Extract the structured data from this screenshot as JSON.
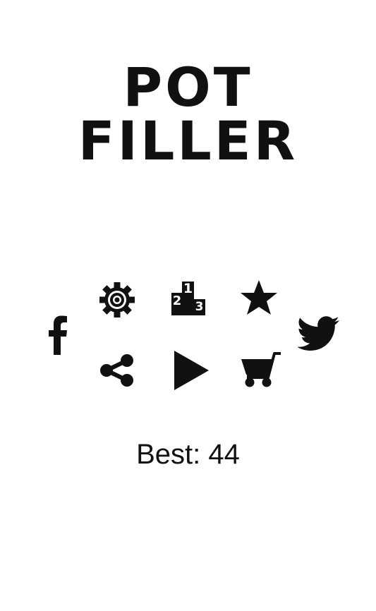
{
  "title": {
    "line1": "POT",
    "line2": "FILLER"
  },
  "buttons": {
    "facebook": {
      "icon": "facebook-icon"
    },
    "settings": {
      "icon": "gear-icon"
    },
    "leaderboard": {
      "icon": "podium-icon",
      "ranks": [
        "1",
        "2",
        "3"
      ]
    },
    "rate": {
      "icon": "star-icon"
    },
    "twitter": {
      "icon": "twitter-icon"
    },
    "share": {
      "icon": "share-icon"
    },
    "play": {
      "icon": "play-icon"
    },
    "shop": {
      "icon": "cart-icon"
    }
  },
  "best_score": {
    "text": "Best: 44"
  },
  "colors": {
    "background": "#ffffff",
    "foreground": "#111111"
  }
}
